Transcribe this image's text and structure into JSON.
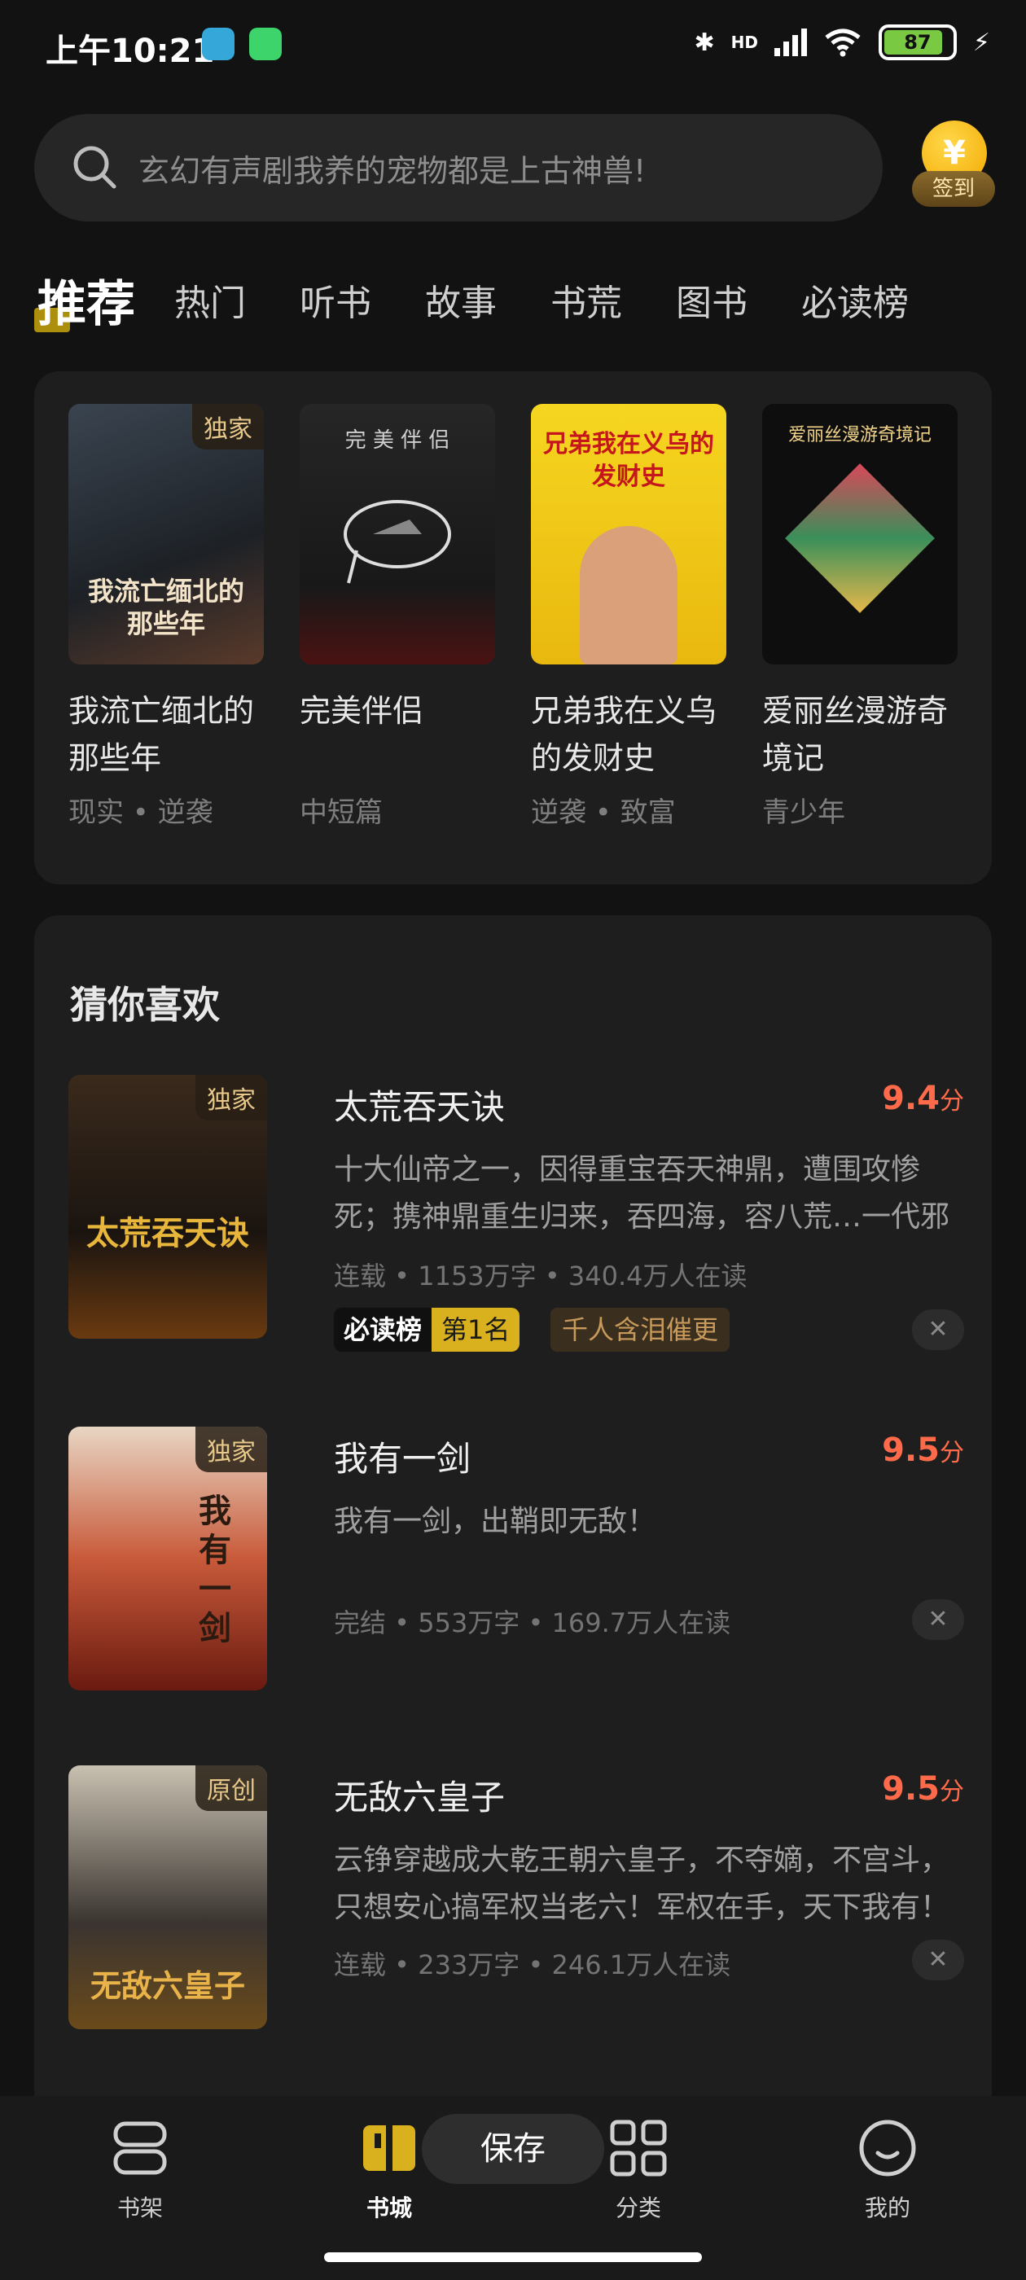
{
  "status_bar": {
    "time": "上午10:21",
    "network_label": "HD",
    "battery": "87"
  },
  "search": {
    "placeholder": "玄幻有声剧我养的宠物都是上古神兽!"
  },
  "signin": {
    "coin_symbol": "¥",
    "label": "签到"
  },
  "tabs": [
    {
      "label": "推荐",
      "active": true
    },
    {
      "label": "热门"
    },
    {
      "label": "听书"
    },
    {
      "label": "故事"
    },
    {
      "label": "书荒"
    },
    {
      "label": "图书"
    },
    {
      "label": "必读榜"
    }
  ],
  "recommended": [
    {
      "title": "我流亡缅北的那些年",
      "subtitle": "现实 • 逆袭",
      "badge": "独家",
      "cover_text": "我流亡缅北的那些年",
      "cover_color": "#2a3038"
    },
    {
      "title": "完美伴侣",
      "subtitle": "中短篇",
      "badge": "",
      "cover_text": "完 美 伴 侣",
      "cover_color": "#1a1a1a"
    },
    {
      "title": "兄弟我在义乌的发财史",
      "subtitle": "逆袭 • 致富",
      "badge": "",
      "cover_text": "兄弟我在义乌的发财史",
      "cover_color": "#f4d21a"
    },
    {
      "title": "爱丽丝漫游奇境记",
      "subtitle": "青少年",
      "badge": "",
      "cover_text": "爱丽丝漫游奇境记",
      "cover_color": "#101010"
    }
  ],
  "guess": {
    "title": "猜你喜欢",
    "books": [
      {
        "title": "太荒吞天诀",
        "score": "9.4",
        "score_unit": "分",
        "desc": "十大仙帝之一，因得重宝吞天神鼎，遭围攻惨死；携神鼎重生归来，吞四海，容八荒…一代邪神，…",
        "meta": "连载 • 1153万字 • 340.4万人在读",
        "badge": "独家",
        "cover_text": "太荒吞天诀",
        "rank_key": "必读榜",
        "rank_value": "第1名",
        "tag": "千人含泪催更"
      },
      {
        "title": "我有一剑",
        "score": "9.5",
        "score_unit": "分",
        "desc": "我有一剑，出鞘即无敌！",
        "meta": "完结 • 553万字 • 169.7万人在读",
        "badge": "独家",
        "cover_text": "我有一剑"
      },
      {
        "title": "无敌六皇子",
        "score": "9.5",
        "score_unit": "分",
        "desc": "云铮穿越成大乾王朝六皇子，不夺嫡，不宫斗，只想安心搞军权当老六！军权在手，天下我有！文…",
        "meta": "连载 • 233万字 • 246.1万人在读",
        "badge": "原创",
        "cover_text": "无敌六皇子"
      }
    ]
  },
  "bottom_nav": [
    {
      "label": "书架",
      "icon": "bookshelf-icon"
    },
    {
      "label": "书城",
      "icon": "bookstore-icon",
      "active": true
    },
    {
      "label": "分类",
      "icon": "category-icon"
    },
    {
      "label": "我的",
      "icon": "profile-icon"
    }
  ],
  "save_label": "保存",
  "close_symbol": "✕"
}
